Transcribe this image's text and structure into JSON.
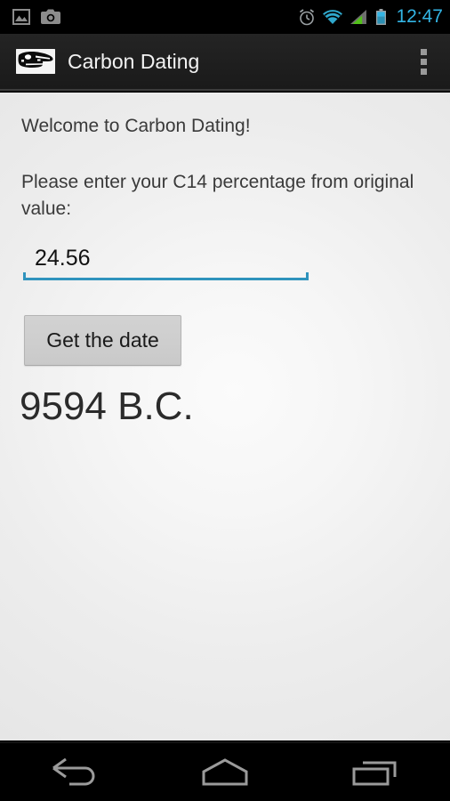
{
  "status_bar": {
    "left_icons": [
      {
        "name": "gallery-image-icon",
        "label": "image"
      },
      {
        "name": "camera-icon",
        "label": "camera"
      }
    ],
    "right_icons": [
      {
        "name": "alarm-clock-icon",
        "label": "alarm"
      },
      {
        "name": "wifi-icon",
        "label": "wifi"
      },
      {
        "name": "cellular-signal-icon",
        "label": "signal"
      },
      {
        "name": "battery-icon",
        "label": "battery"
      }
    ],
    "clock": "12:47",
    "clock_color": "#33b5e5",
    "background_color": "#000000"
  },
  "action_bar": {
    "app_icon_name": "dinosaur-skull-icon",
    "title": "Carbon Dating",
    "overflow_label": "More options",
    "background_color": "#1b1b1b",
    "title_color": "#f2f2f2"
  },
  "main": {
    "welcome_text": "Welcome to Carbon Dating!",
    "prompt_text": "Please enter your C14 percentage from original value:",
    "input": {
      "value": "24.56",
      "placeholder": "",
      "underline_color": "#2f93bd"
    },
    "button_label": "Get the date",
    "result_text": "9594 B.C.",
    "background_color": "#efefef",
    "text_color": "#3a3a3a"
  },
  "nav_bar": {
    "buttons": [
      {
        "name": "back-button",
        "label": "Back"
      },
      {
        "name": "home-button",
        "label": "Home"
      },
      {
        "name": "recents-button",
        "label": "Recent apps"
      }
    ],
    "background_color": "#000000",
    "icon_color": "#9b9b9b"
  }
}
